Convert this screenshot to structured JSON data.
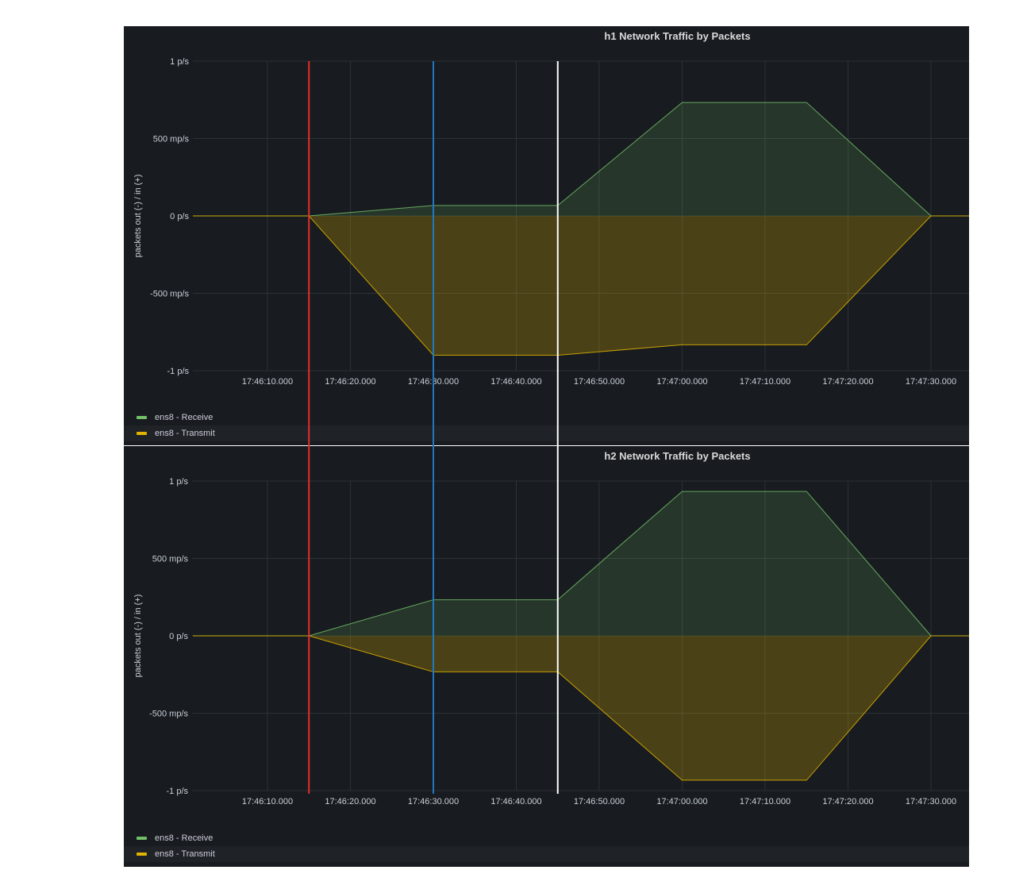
{
  "colors": {
    "receive": "#73bf69",
    "transmit": "#e0b400",
    "grid": "#2c3235",
    "axis_text": "#c7d0d9",
    "marker_red": "#e02f2f",
    "marker_blue": "#1f78c1",
    "marker_white": "#ffffff"
  },
  "panels": [
    {
      "title": "h1 Network Traffic by Packets",
      "legend": [
        "ens8 - Receive",
        "ens8 - Transmit"
      ]
    },
    {
      "title": "h2 Network Traffic by Packets",
      "legend": [
        "ens8 - Receive",
        "ens8 - Transmit"
      ]
    }
  ],
  "chart_data": [
    {
      "type": "area",
      "title": "h1 Network Traffic by Packets",
      "ylabel": "packets out (-) / in (+)",
      "xlabel": "",
      "x_ticks": [
        "17:46:10.000",
        "17:46:20.000",
        "17:46:30.000",
        "17:46:40.000",
        "17:46:50.000",
        "17:47:00.000",
        "17:47:10.000",
        "17:47:20.000",
        "17:47:30.000"
      ],
      "y_ticks": [
        "1 p/s",
        "500 mp/s",
        "0 p/s",
        "-500 mp/s",
        "-1 p/s"
      ],
      "ylim": [
        -1,
        1
      ],
      "x": [
        "17:46:01",
        "17:46:15",
        "17:46:30",
        "17:46:45",
        "17:47:00",
        "17:47:15",
        "17:47:30",
        "17:47:35"
      ],
      "series": [
        {
          "name": "ens8 - Receive",
          "values": [
            0,
            0,
            0.067,
            0.067,
            0.733,
            0.733,
            0,
            0
          ]
        },
        {
          "name": "ens8 - Transmit",
          "values": [
            0,
            0,
            -0.9,
            -0.9,
            -0.833,
            -0.833,
            0,
            0
          ]
        }
      ],
      "markers": [
        "17:46:15",
        "17:46:30",
        "17:46:45"
      ],
      "grid": true,
      "legend_position": "bottom-left"
    },
    {
      "type": "area",
      "title": "h2 Network Traffic by Packets",
      "ylabel": "packets out (-) / in (+)",
      "xlabel": "",
      "x_ticks": [
        "17:46:10.000",
        "17:46:20.000",
        "17:46:30.000",
        "17:46:40.000",
        "17:46:50.000",
        "17:47:00.000",
        "17:47:10.000",
        "17:47:20.000",
        "17:47:30.000"
      ],
      "y_ticks": [
        "1 p/s",
        "500 mp/s",
        "0 p/s",
        "-500 mp/s",
        "-1 p/s"
      ],
      "ylim": [
        -1,
        1
      ],
      "x": [
        "17:46:01",
        "17:46:15",
        "17:46:30",
        "17:46:45",
        "17:47:00",
        "17:47:15",
        "17:47:30",
        "17:47:35"
      ],
      "series": [
        {
          "name": "ens8 - Receive",
          "values": [
            0,
            0,
            0.233,
            0.233,
            0.933,
            0.933,
            0,
            0
          ]
        },
        {
          "name": "ens8 - Transmit",
          "values": [
            0,
            0,
            -0.233,
            -0.233,
            -0.933,
            -0.933,
            0,
            0
          ]
        }
      ],
      "markers": [
        "17:46:15",
        "17:46:30",
        "17:46:45"
      ],
      "grid": true,
      "legend_position": "bottom-left"
    }
  ]
}
